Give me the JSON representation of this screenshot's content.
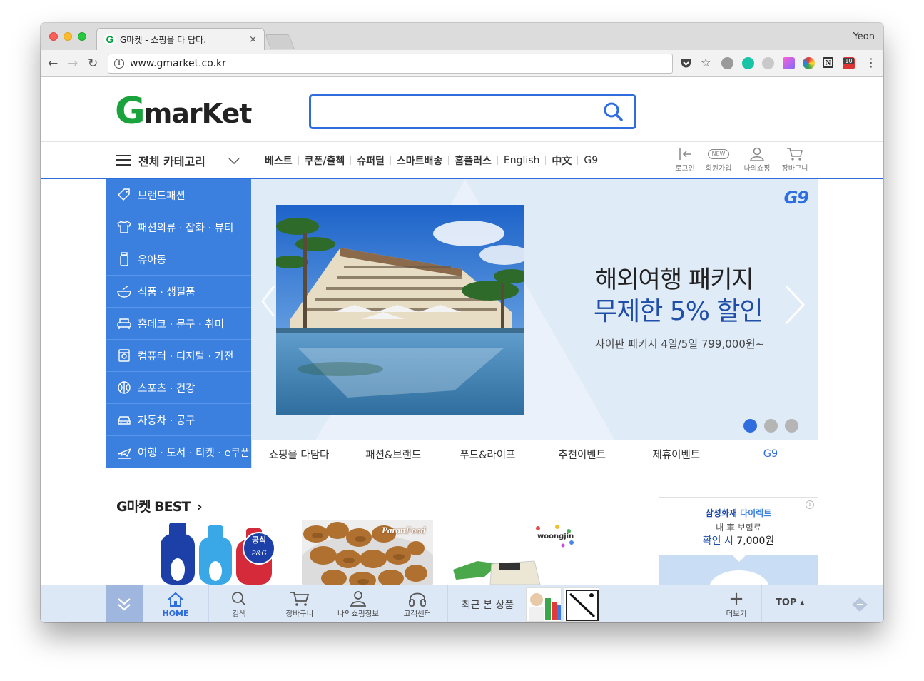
{
  "browser": {
    "tab_title": "G마켓 - 쇼핑을 다 담다.",
    "favicon_letter": "G",
    "tab_close": "×",
    "profile_name": "Yeon",
    "url": "www.gmarket.co.kr",
    "info_glyph": "i",
    "back_glyph": "←",
    "forward_glyph": "→",
    "reload_glyph": "↻",
    "menu_glyph": "⋮",
    "star_glyph": "☆",
    "ext_badge": "10"
  },
  "header": {
    "logo_g": "G",
    "logo_rest": "marKet",
    "search_placeholder": ""
  },
  "catbar": {
    "all_categories": "전체 카테고리",
    "nav": [
      "베스트",
      "쿠폰/출첵",
      "슈퍼딜",
      "스마트배송",
      "홈플러스",
      "English",
      "中文",
      "G9"
    ],
    "utils": [
      {
        "label": "로그인",
        "icon": "login-icon"
      },
      {
        "label": "회원가입",
        "icon": "new-member-icon",
        "badge": "NEW"
      },
      {
        "label": "나의쇼핑",
        "icon": "user-icon"
      },
      {
        "label": "장바구니",
        "icon": "cart-icon"
      }
    ]
  },
  "sidebar": {
    "items": [
      {
        "label": "브랜드패션",
        "icon": "tag-icon"
      },
      {
        "label": "패션의류 · 잡화 · 뷰티",
        "icon": "shirt-icon"
      },
      {
        "label": "유아동",
        "icon": "bottle-icon"
      },
      {
        "label": "식품 · 생필품",
        "icon": "bowl-icon"
      },
      {
        "label": "홈데코 · 문구 · 취미",
        "icon": "sofa-icon"
      },
      {
        "label": "컴퓨터 · 디지털 · 가전",
        "icon": "device-icon"
      },
      {
        "label": "스포츠 · 건강",
        "icon": "ball-icon"
      },
      {
        "label": "자동차 · 공구",
        "icon": "car-icon"
      },
      {
        "label": "여행 · 도서 · 티켓 · e쿠폰",
        "icon": "plane-icon"
      }
    ]
  },
  "hero": {
    "badge": "G9",
    "title_line1": "해외여행 패키지",
    "title_line2": "무제한 5% 할인",
    "subtitle": "사이판 패키지 4일/5일 799,000원~",
    "slide_count": 3,
    "active_slide": 1,
    "tabs": [
      "쇼핑을 다담다",
      "패션&브랜드",
      "푸드&라이프",
      "추천이벤트",
      "제휴이벤트",
      "G9"
    ]
  },
  "best": {
    "title": "G마켓 BEST",
    "title_arrow": "›",
    "products": [
      {
        "badge_top": "공식",
        "badge_bottom": "P&G"
      },
      {
        "brand": "ParanFood"
      },
      {
        "brand": "woongjin"
      }
    ]
  },
  "ad": {
    "brand": "삼성화재",
    "brand_suffix": "다이렉트",
    "line2": "내 車 보험료",
    "line3_prefix": "확인 시",
    "line3_amount": "7,000원",
    "info_glyph": "i"
  },
  "bottombar": {
    "items": [
      {
        "label": "HOME",
        "icon": "home-icon"
      },
      {
        "label": "검색",
        "icon": "search-icon"
      },
      {
        "label": "장바구니",
        "icon": "cart-icon"
      },
      {
        "label": "나의쇼핑정보",
        "icon": "user-icon"
      },
      {
        "label": "고객센터",
        "icon": "headset-icon"
      }
    ],
    "recent_label": "최근 본 상품",
    "more_label": "더보기",
    "more_glyph": "+",
    "top_label": "TOP ▴"
  },
  "colors": {
    "brand_blue": "#2f6dde",
    "sidebar_blue": "#3b80df",
    "logo_green": "#1aa33c",
    "hero_bg": "#e0ebf8",
    "bottombar_bg": "#dde8f7"
  }
}
